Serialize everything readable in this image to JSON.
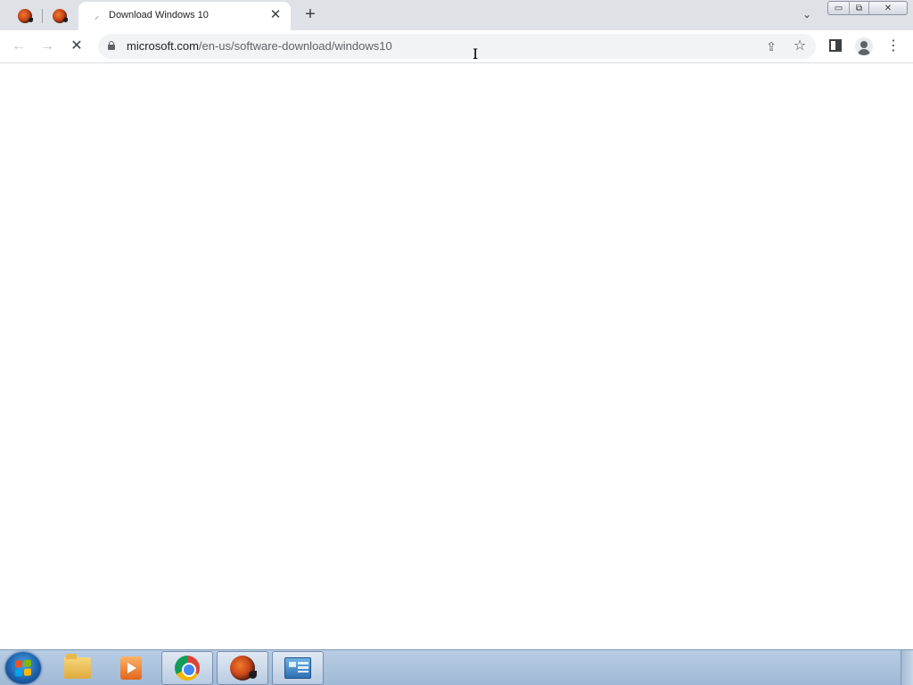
{
  "browser": {
    "active_tab": {
      "title": "Download Windows 10",
      "loading_glyph": "⸝"
    },
    "pinned_tabs": [
      {
        "icon": "app-logo-icon"
      },
      {
        "icon": "app-logo-icon"
      }
    ],
    "new_tab_glyph": "+",
    "tab_search_glyph": "⌄",
    "window_controls": {
      "minimize": "▭",
      "restore": "⧉",
      "close": "✕"
    },
    "toolbar": {
      "back_glyph": "←",
      "forward_glyph": "→",
      "stop_glyph": "✕",
      "url_host": "microsoft.com",
      "url_path": "/en-us/software-download/windows10",
      "share_glyph": "⇪",
      "bookmark_glyph": "☆",
      "menu_glyph": "⋮"
    },
    "text_cursor_glyph": "I"
  },
  "taskbar": {
    "apps": [
      {
        "name": "file-explorer",
        "active": false
      },
      {
        "name": "media-player",
        "active": false
      },
      {
        "name": "google-chrome",
        "active": true
      },
      {
        "name": "app",
        "active": true
      },
      {
        "name": "control-panel",
        "active": true
      }
    ]
  },
  "colors": {
    "tabstrip": "#dee1e6",
    "omnibox": "#f1f3f4",
    "taskbar": "#b9cde4"
  }
}
